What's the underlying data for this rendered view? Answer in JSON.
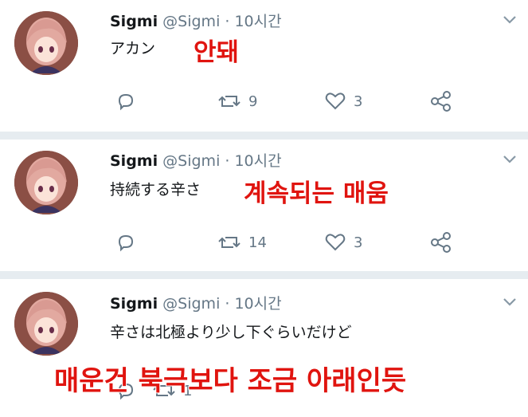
{
  "tweets": [
    {
      "name": "Sigmi",
      "handle": "@Sigmi",
      "time": "· 10시간",
      "text": "アカン",
      "overlay": "안돼",
      "retweets": "9",
      "likes": "3"
    },
    {
      "name": "Sigmi",
      "handle": "@Sigmi",
      "time": "· 10시간",
      "text": "持続する辛さ",
      "overlay": "계속되는 매움",
      "retweets": "14",
      "likes": "3"
    },
    {
      "name": "Sigmi",
      "handle": "@Sigmi",
      "time": "· 10시간",
      "text": "辛さは北極より少し下ぐらいだけど",
      "overlay": "매운건 북극보다 조금 아래인듯",
      "retweets": "1",
      "likes": ""
    }
  ],
  "colors": {
    "accent": "#e0140f",
    "muted": "#657786",
    "divider": "#e6ecf0"
  },
  "icons": [
    "reply-icon",
    "retweet-icon",
    "like-icon",
    "share-icon",
    "chevron-down-icon"
  ]
}
